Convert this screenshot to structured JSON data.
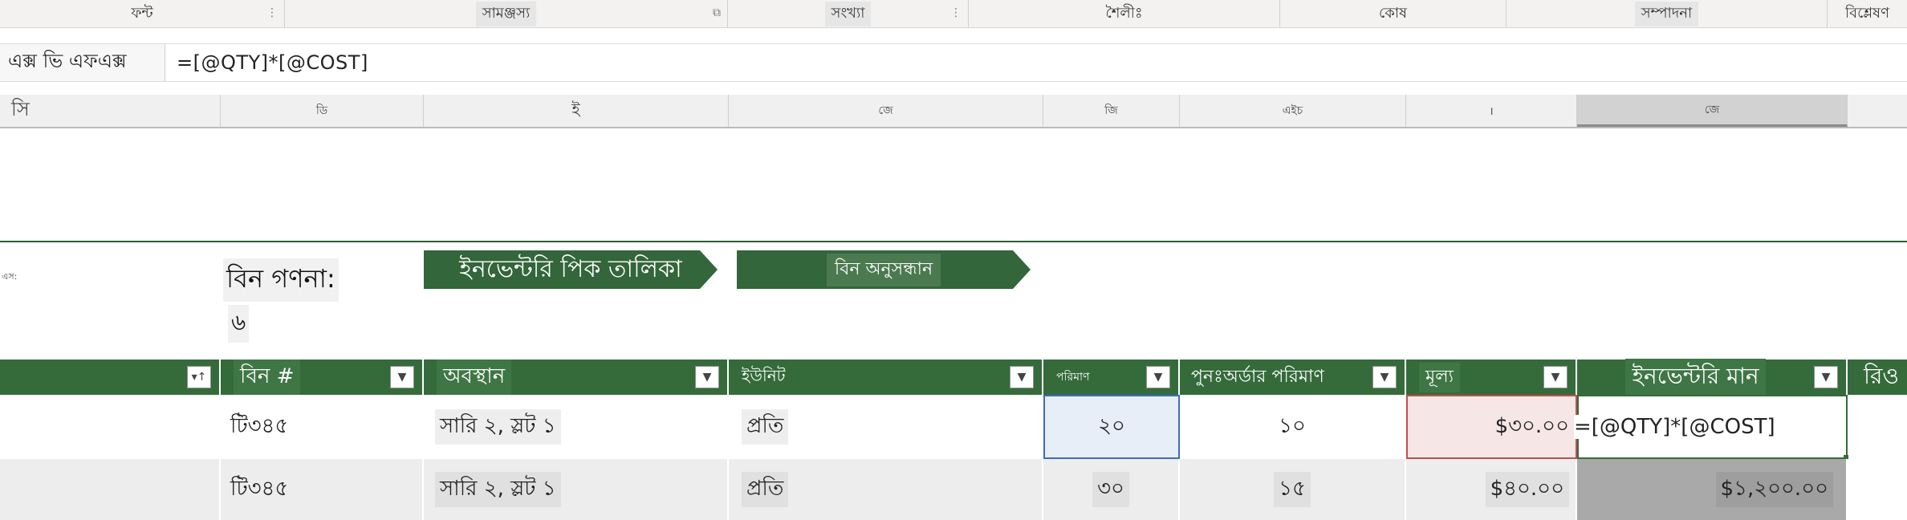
{
  "ribbon": {
    "groups": [
      "ফন্ট",
      "সামঞ্জস্য",
      "সংখ্যা",
      "শৈলীঃ",
      "কোষ",
      "সম্পাদনা",
      "বিশ্লেষণ"
    ]
  },
  "formula_bar": {
    "name_box": "এক্স ভি এফএক্স",
    "formula": "=[@QTY]*[@COST]"
  },
  "column_headers": [
    "সি",
    "ডি",
    "ই",
    "জে",
    "জি",
    "এইচ",
    "।",
    "জে"
  ],
  "sheet": {
    "corner_label": "এস:",
    "bin_count_label": "বিন গণনা:",
    "bin_count_value": "৬",
    "btn_pick_table": "ইনভেন্টরি পিক তালিকা",
    "btn_bin_search": "বিন অনুসন্ধান"
  },
  "table": {
    "headers": [
      "বিন #",
      "অবস্থান",
      "ইউনিট",
      "পরিমাণ",
      "পুনঃঅর্ডার পরিমাণ",
      "মূল্য",
      "ইনভেন্টরি মান",
      "রিও"
    ],
    "rows": [
      {
        "bin": "টি৩৪৫",
        "location": "সারি ২, স্লট ১",
        "unit": "প্রতি",
        "qty": "২০",
        "reorder": "১০",
        "cost": "$৩০.০০",
        "value": "=[@QTY]*[@COST]"
      },
      {
        "bin": "টি৩৪৫",
        "location": "সারি ২, স্লট ১",
        "unit": "প্রতি",
        "qty": "৩০",
        "reorder": "১৫",
        "cost": "$৪০.০০",
        "value": "$১,২০০.০০"
      }
    ]
  },
  "colors": {
    "header_green": "#356b3b",
    "qty_select": "#3b6cc0",
    "cost_select": "#c0504d"
  }
}
